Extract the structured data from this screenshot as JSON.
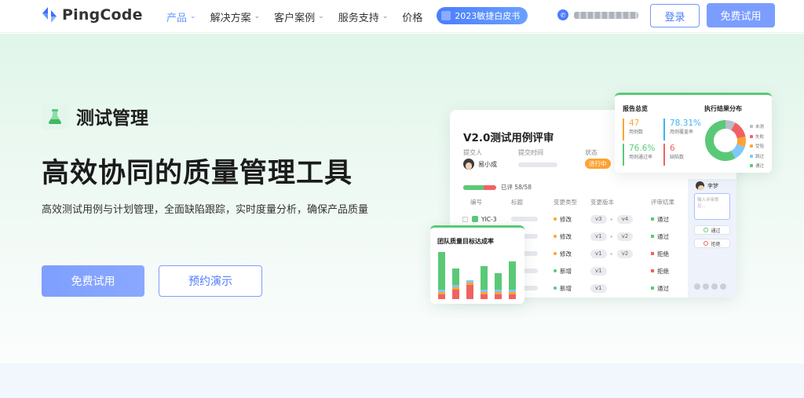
{
  "nav": {
    "logo_text": "PingCode",
    "menu": [
      {
        "label": "产品",
        "dropdown": true,
        "active": true
      },
      {
        "label": "解决方案",
        "dropdown": true,
        "active": false
      },
      {
        "label": "客户案例",
        "dropdown": true,
        "active": false
      },
      {
        "label": "服务支持",
        "dropdown": true,
        "active": false
      },
      {
        "label": "价格",
        "dropdown": false,
        "active": false
      }
    ],
    "badge_label": "2023敏捷白皮书",
    "login_label": "登录",
    "trial_label": "免费试用"
  },
  "hero": {
    "product_name": "测试管理",
    "headline": "高效协同的质量管理工具",
    "subhead": "高效测试用例与计划管理，全面缺陷跟踪，实时度量分析，确保产品质量",
    "primary_cta": "免费试用",
    "secondary_cta": "预约演示"
  },
  "review": {
    "title": "V2.0测试用例评审",
    "labels": {
      "submitter": "提交人",
      "submit_time": "提交时间",
      "status": "状态"
    },
    "submitter_name": "易小成",
    "status": "进行中",
    "progress_text": "已评 58/58",
    "progress_fraction": 0.62,
    "columns": [
      "编号",
      "标题",
      "变更类型",
      "变更版本",
      "评审结果"
    ],
    "rows": [
      {
        "id": "YIC-3",
        "change_type": "修改",
        "change_color": "#ffa334",
        "versions": [
          "v3",
          "v4"
        ],
        "result": "通过",
        "result_color": "#5ac977"
      },
      {
        "id": "",
        "change_type": "修改",
        "change_color": "#ffa334",
        "versions": [
          "v1",
          "v2"
        ],
        "result": "通过",
        "result_color": "#5ac977"
      },
      {
        "id": "",
        "change_type": "修改",
        "change_color": "#ffa334",
        "versions": [
          "v1",
          "v2"
        ],
        "result": "拒绝",
        "result_color": "#f06262"
      },
      {
        "id": "",
        "change_type": "新增",
        "change_color": "#5ac977",
        "versions": [
          "v1"
        ],
        "result": "拒绝",
        "result_color": "#f06262"
      },
      {
        "id": "",
        "change_type": "新增",
        "change_color": "#5ac977",
        "versions": [
          "v1"
        ],
        "result": "通过",
        "result_color": "#5ac977"
      }
    ],
    "reviewer_name": "李梦",
    "comment_placeholder": "输入评审意见...",
    "approve_label": "通过",
    "reject_label": "拒绝"
  },
  "report": {
    "title": "报告总览",
    "stats": [
      {
        "value": "47",
        "label": "用例数",
        "color": "#ffa334"
      },
      {
        "value": "78.31%",
        "label": "用例覆盖率",
        "color": "#3db3f5"
      },
      {
        "value": "76.6%",
        "label": "用例通过率",
        "color": "#5ac977"
      },
      {
        "value": "6",
        "label": "缺陷数",
        "color": "#f06262"
      }
    ],
    "distribution_title": "执行结果分布",
    "distribution": [
      {
        "label": "未测",
        "value": 8,
        "color": "#b8bec9"
      },
      {
        "label": "失败",
        "value": 14,
        "color": "#f06262"
      },
      {
        "label": "受阻",
        "value": 8,
        "color": "#ffa334"
      },
      {
        "label": "跳过",
        "value": 12,
        "color": "#7fc8f8"
      },
      {
        "label": "通过",
        "value": 58,
        "color": "#5ac977"
      }
    ]
  },
  "quality": {
    "title": "团队质量目标达成率",
    "bars": [
      [
        0.1,
        0.05,
        0.05,
        0.8
      ],
      [
        0.2,
        0.05,
        0.05,
        0.35
      ],
      [
        0.3,
        0.05,
        0.05,
        0.0
      ],
      [
        0.1,
        0.05,
        0.05,
        0.5
      ],
      [
        0.1,
        0.05,
        0.05,
        0.35
      ],
      [
        0.1,
        0.05,
        0.05,
        0.6
      ]
    ],
    "bar_colors": [
      "#f06262",
      "#ffa334",
      "#7fc8f8",
      "#5ac977"
    ]
  }
}
